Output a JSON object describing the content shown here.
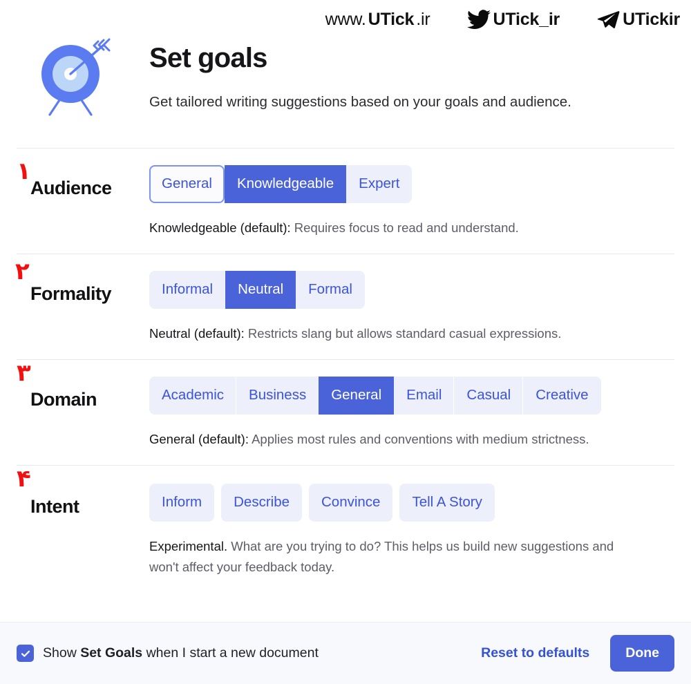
{
  "watermarks": [
    {
      "icon": "globe-text-icon",
      "light_prefix": "www.",
      "bold": "UTick",
      "light_suffix": ".ir"
    },
    {
      "icon": "twitter-icon",
      "light_prefix": "",
      "bold": "UTick_ir",
      "light_suffix": ""
    },
    {
      "icon": "telegram-icon",
      "light_prefix": "",
      "bold": "UTickir",
      "light_suffix": ""
    }
  ],
  "header": {
    "icon": "target-arrow-icon",
    "title": "Set goals",
    "subtitle": "Get tailored writing suggestions based on your goals and audience."
  },
  "sections": [
    {
      "marker": "۱",
      "label": "Audience",
      "control": "segmented",
      "options": [
        {
          "label": "General",
          "state": "focused"
        },
        {
          "label": "Knowledgeable",
          "state": "selected"
        },
        {
          "label": "Expert",
          "state": "normal"
        }
      ],
      "desc_strong": "Knowledgeable (default):",
      "desc_rest": " Requires focus to read and understand."
    },
    {
      "marker": "۲",
      "label": "Formality",
      "control": "segmented",
      "options": [
        {
          "label": "Informal",
          "state": "normal"
        },
        {
          "label": "Neutral",
          "state": "selected"
        },
        {
          "label": "Formal",
          "state": "normal"
        }
      ],
      "desc_strong": "Neutral (default):",
      "desc_rest": " Restricts slang but allows standard casual expressions."
    },
    {
      "marker": "۳",
      "label": "Domain",
      "control": "segmented",
      "options": [
        {
          "label": "Academic",
          "state": "normal"
        },
        {
          "label": "Business",
          "state": "normal"
        },
        {
          "label": "General",
          "state": "selected"
        },
        {
          "label": "Email",
          "state": "normal"
        },
        {
          "label": "Casual",
          "state": "normal"
        },
        {
          "label": "Creative",
          "state": "normal"
        }
      ],
      "desc_strong": "General (default):",
      "desc_rest": " Applies most rules and conventions with medium strictness."
    },
    {
      "marker": "۴",
      "label": "Intent",
      "control": "pills",
      "options": [
        {
          "label": "Inform",
          "state": "normal"
        },
        {
          "label": "Describe",
          "state": "normal"
        },
        {
          "label": "Convince",
          "state": "normal"
        },
        {
          "label": "Tell A Story",
          "state": "normal"
        }
      ],
      "desc_strong": "Experimental.",
      "desc_rest": " What are you trying to do? This helps us build new suggestions and won't affect your feedback today."
    }
  ],
  "footer": {
    "checkbox_checked": true,
    "checkbox_icon": "checkmark-icon",
    "label_prefix": "Show ",
    "label_bold": "Set Goals",
    "label_suffix": " when I start a new document",
    "reset_label": "Reset to defaults",
    "done_label": "Done"
  },
  "colors": {
    "accent": "#4a63d8",
    "accent_text": "#3b54d8",
    "pill_bg": "#edeffb",
    "marker_red": "#f10f0f",
    "footer_bg": "#f8f9fd"
  }
}
